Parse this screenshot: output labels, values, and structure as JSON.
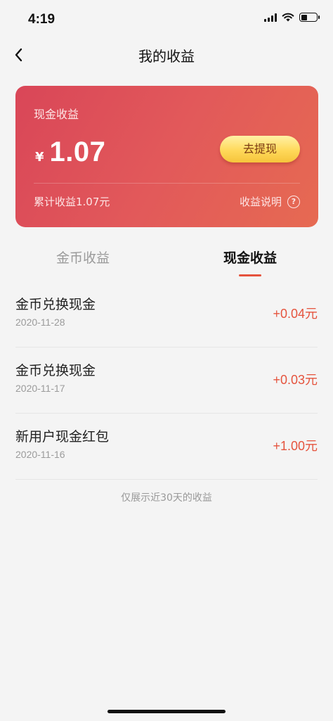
{
  "status_bar": {
    "time": "4:19",
    "icons": [
      "signal-icon",
      "wifi-icon",
      "battery-icon"
    ]
  },
  "nav": {
    "back_icon": "chevron-left-icon",
    "title": "我的收益"
  },
  "card": {
    "title": "现金收益",
    "currency": "¥",
    "amount": "1.07",
    "withdraw_label": "去提现",
    "total_label": "累计收益1.07元",
    "explain_label": "收益说明",
    "help_icon": "question-circle-icon",
    "colors": {
      "start": "#d94658",
      "end": "#e66a52",
      "button": "#ffd95a"
    }
  },
  "tabs": [
    {
      "label": "金币收益",
      "active": false
    },
    {
      "label": "现金收益",
      "active": true
    }
  ],
  "accent_color": "#e5533d",
  "records": [
    {
      "title": "金币兑换现金",
      "date": "2020-11-28",
      "amount": "+0.04元"
    },
    {
      "title": "金币兑换现金",
      "date": "2020-11-17",
      "amount": "+0.03元"
    },
    {
      "title": "新用户现金红包",
      "date": "2020-11-16",
      "amount": "+1.00元"
    }
  ],
  "footer_note": "仅展示近30天的收益"
}
